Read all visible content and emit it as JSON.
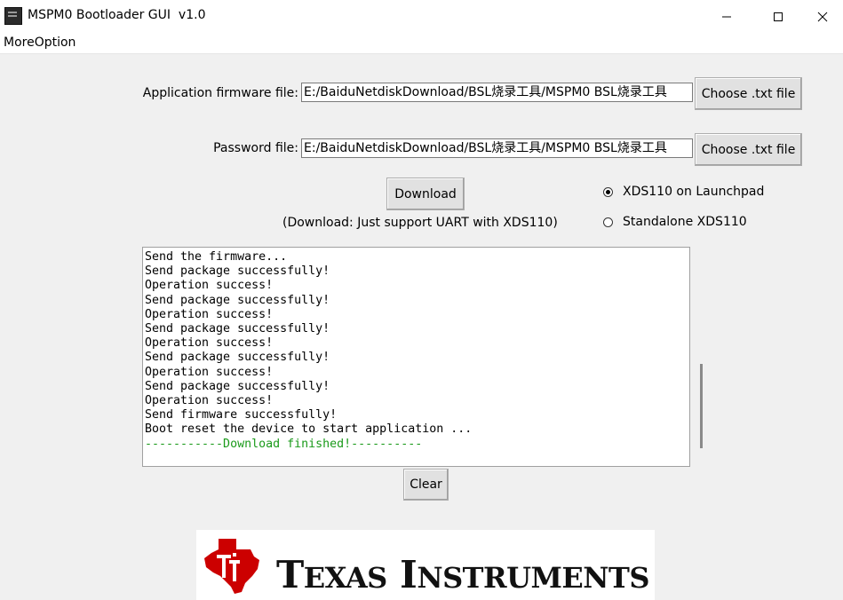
{
  "window": {
    "title": "MSPM0 Bootloader GUI  v1.0",
    "controls": {
      "minimize": "minimize-icon",
      "maximize": "maximize-icon",
      "close": "close-icon"
    }
  },
  "menu": {
    "items": [
      "MoreOption"
    ]
  },
  "form": {
    "app_firmware_label": "Application firmware file:",
    "app_firmware_path": "E:/BaiduNetdiskDownload/BSL烧录工具/MSPM0 BSL烧录工具",
    "password_label": "Password file:",
    "password_path": "E:/BaiduNetdiskDownload/BSL烧录工具/MSPM0 BSL烧录工具",
    "choose_label": "Choose .txt file",
    "download_label": "Download",
    "download_note": "(Download: Just support UART with XDS110)"
  },
  "radios": [
    {
      "label": "XDS110 on Launchpad",
      "selected": true
    },
    {
      "label": "Standalone XDS110",
      "selected": false
    }
  ],
  "log": {
    "lines": [
      "Send the firmware...",
      "Send package successfully!",
      "Operation success!",
      "Send package successfully!",
      "Operation success!",
      "Send package successfully!",
      "Operation success!",
      "Send package successfully!",
      "Operation success!",
      "Send package successfully!",
      "Operation success!",
      "Send firmware successfully!",
      "Boot reset the device to start application ..."
    ],
    "finish_line": "-----------Download finished!----------",
    "finish_color": "#1a9a1a"
  },
  "clear_label": "Clear",
  "logo": {
    "brand_color": "#cc0000",
    "word1_initial": "T",
    "word1_rest": "EXAS",
    "word2_initial": "I",
    "word2_rest": "NSTRUMENTS"
  }
}
